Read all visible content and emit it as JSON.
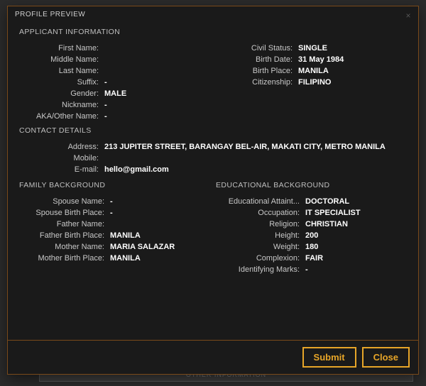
{
  "backdrop_label": "OTHER INFORMATION",
  "header": {
    "title": "PROFILE PREVIEW",
    "close_x": "×"
  },
  "sections": {
    "applicant": "APPLICANT INFORMATION",
    "contact": "CONTACT DETAILS",
    "family": "FAMILY BACKGROUND",
    "education": "EDUCATIONAL BACKGROUND"
  },
  "applicant": {
    "left": {
      "first_name": {
        "label": "First Name:",
        "value": ""
      },
      "middle_name": {
        "label": "Middle Name:",
        "value": ""
      },
      "last_name": {
        "label": "Last Name:",
        "value": ""
      },
      "suffix": {
        "label": "Suffix:",
        "value": "-"
      },
      "gender": {
        "label": "Gender:",
        "value": "MALE"
      },
      "nickname": {
        "label": "Nickname:",
        "value": "-"
      },
      "aka": {
        "label": "AKA/Other Name:",
        "value": "-"
      }
    },
    "right": {
      "civil_status": {
        "label": "Civil Status:",
        "value": "SINGLE"
      },
      "birth_date": {
        "label": "Birth Date:",
        "value": "31 May 1984"
      },
      "birth_place": {
        "label": "Birth Place:",
        "value": "MANILA"
      },
      "citizenship": {
        "label": "Citizenship:",
        "value": "FILIPINO"
      }
    }
  },
  "contact": {
    "address": {
      "label": "Address:",
      "value": "213 JUPITER STREET, BARANGAY BEL-AIR, MAKATI CITY, METRO MANILA"
    },
    "mobile": {
      "label": "Mobile:",
      "value": ""
    },
    "email": {
      "label": "E-mail:",
      "value": "hello@gmail.com"
    }
  },
  "family": {
    "spouse_name": {
      "label": "Spouse Name:",
      "value": "-"
    },
    "spouse_birth_place": {
      "label": "Spouse Birth Place:",
      "value": "-"
    },
    "father_name": {
      "label": "Father Name:",
      "value": ""
    },
    "father_birth_place": {
      "label": "Father Birth Place:",
      "value": "MANILA"
    },
    "mother_name": {
      "label": "Mother Name:",
      "value": "MARIA SALAZAR"
    },
    "mother_birth_place": {
      "label": "Mother Birth Place:",
      "value": "MANILA"
    }
  },
  "education": {
    "attainment": {
      "label": "Educational Attaint...",
      "value": "DOCTORAL"
    },
    "occupation": {
      "label": "Occupation:",
      "value": "IT SPECIALIST"
    },
    "religion": {
      "label": "Religion:",
      "value": "CHRISTIAN"
    },
    "height": {
      "label": "Height:",
      "value": "200"
    },
    "weight": {
      "label": "Weight:",
      "value": "180"
    },
    "complexion": {
      "label": "Complexion:",
      "value": "FAIR"
    },
    "marks": {
      "label": "Identifying Marks:",
      "value": "-"
    }
  },
  "footer": {
    "submit": "Submit",
    "close": "Close"
  }
}
